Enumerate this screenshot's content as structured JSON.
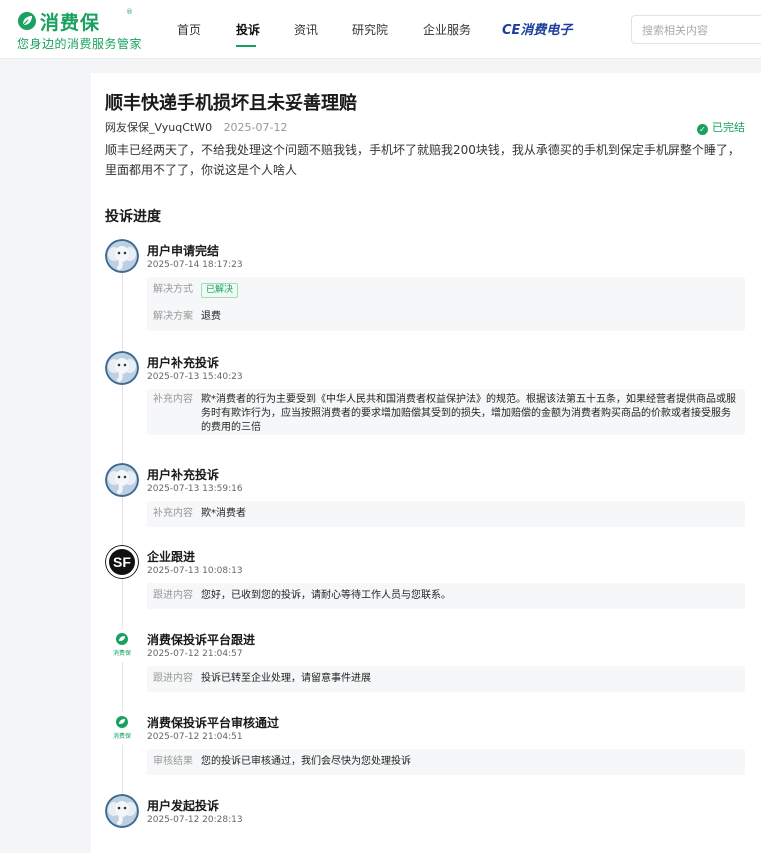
{
  "header": {
    "logo_name": "消费保",
    "logo_reg": "®",
    "logo_slogan": "您身边的消费服务管家",
    "nav": [
      {
        "label": "首页"
      },
      {
        "label": "投诉"
      },
      {
        "label": "资讯"
      },
      {
        "label": "研究院"
      },
      {
        "label": "企业服务"
      }
    ],
    "nav_ce_label": "CE消费电子",
    "search_placeholder": "搜索相关内容"
  },
  "complaint": {
    "title": "顺丰快递手机损坏且未妥善理赔",
    "user": "网友保保_VyuqCtW0",
    "date": "2025-07-12",
    "status": "已完结",
    "description": "顺丰已经两天了，不给我处理这个问题不赔我钱，手机坏了就赔我200块钱，我从承德买的手机到保定手机屏整个睡了，里面都用不了了，你说这是个人啥人"
  },
  "progress": {
    "section_title": "投诉进度",
    "entries": [
      {
        "avatar": "elephant-avatar",
        "title": "用户申请完结",
        "time": "2025-07-14 18:17:23",
        "details": [
          {
            "label": "解决方式",
            "tag": "已解决"
          },
          {
            "label": "解决方案",
            "value": "退费"
          }
        ]
      },
      {
        "avatar": "elephant-avatar",
        "title": "用户补充投诉",
        "time": "2025-07-13 15:40:23",
        "details": [
          {
            "label": "补充内容",
            "value": "欺*消费者的行为主要受到《中华人民共和国消费者权益保护法》的规范。根据该法第五十五条，如果经营者提供商品或服务时有欺诈行为，应当按照消费者的要求增加赔偿其受到的损失，增加赔偿的金额为消费者购买商品的价款或者接受服务的费用的三倍"
          }
        ]
      },
      {
        "avatar": "elephant-avatar",
        "title": "用户补充投诉",
        "time": "2025-07-13 13:59:16",
        "details": [
          {
            "label": "补充内容",
            "value": "欺*消费者"
          }
        ]
      },
      {
        "avatar": "sf-logo-avatar",
        "avatar_text": "SF",
        "title": "企业跟进",
        "time": "2025-07-13 10:08:13",
        "details": [
          {
            "label": "跟进内容",
            "value": "您好，已收到您的投诉，请耐心等待工作人员与您联系。"
          }
        ]
      },
      {
        "avatar": "platform-logo-avatar",
        "avatar_text": "消费保",
        "title": "消费保投诉平台跟进",
        "time": "2025-07-12 21:04:57",
        "details": [
          {
            "label": "跟进内容",
            "value": "投诉已转至企业处理，请留意事件进展"
          }
        ]
      },
      {
        "avatar": "platform-logo-avatar",
        "avatar_text": "消费保",
        "title": "消费保投诉平台审核通过",
        "time": "2025-07-12 21:04:51",
        "details": [
          {
            "label": "审核结果",
            "value": "您的投诉已审核通过，我们会尽快为您处理投诉"
          }
        ]
      },
      {
        "avatar": "elephant-avatar",
        "title": "用户发起投诉",
        "time": "2025-07-12 20:28:13",
        "details": []
      }
    ]
  },
  "colors": {
    "brand_green": "#19a15f",
    "ce_blue": "#1d3f9c",
    "avatar_blue": "#3f6a92"
  }
}
